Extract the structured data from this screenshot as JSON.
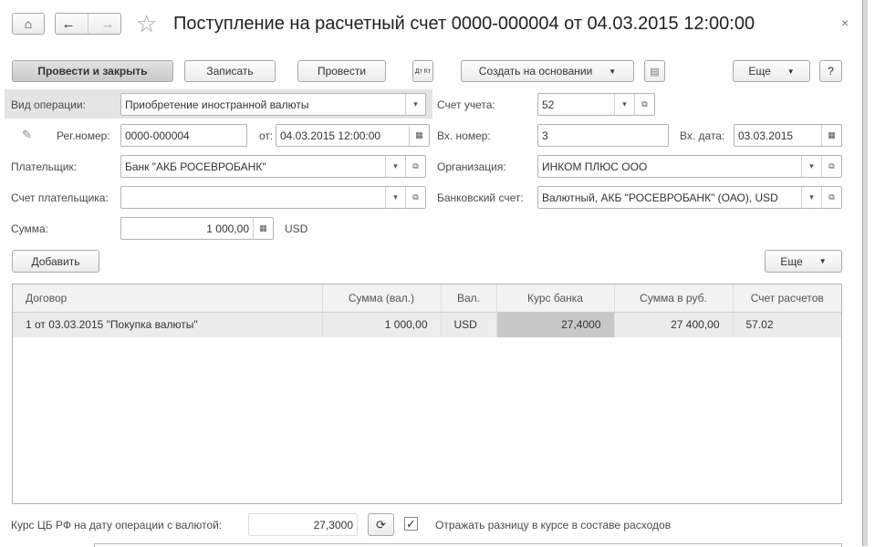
{
  "header": {
    "title": "Поступление на расчетный счет 0000-000004 от 04.03.2015 12:00:00",
    "home_icon": "home-icon",
    "back_icon": "arrow-left-icon",
    "forward_icon": "arrow-right-icon",
    "favorite_icon": "star-icon",
    "close_icon": "close-icon"
  },
  "toolbar": {
    "post_close": "Провести и закрыть",
    "save": "Записать",
    "post": "Провести",
    "dtkt": "Дт Кт",
    "create_based": "Создать на основании",
    "more": "Еще",
    "help": "?"
  },
  "form": {
    "operation_label": "Вид операции:",
    "operation_value": "Приобретение иностранной валюты",
    "account_label": "Счет учета:",
    "account_value": "52",
    "reg_label": "Рег.номер:",
    "reg_value": "0000-000004",
    "from_label": "от:",
    "from_value": "04.03.2015 12:00:00",
    "in_number_label": "Вх. номер:",
    "in_number_value": "3",
    "in_date_label": "Вх. дата:",
    "in_date_value": "03.03.2015",
    "payer_label": "Плательщик:",
    "payer_value": "Банк \"АКБ РОСЕВРОБАНК\"",
    "org_label": "Организация:",
    "org_value": "ИНКОМ ПЛЮС ООО",
    "payer_account_label": "Счет плательщика:",
    "payer_account_value": "",
    "bank_account_label": "Банковский счет:",
    "bank_account_value": "Валютный, АКБ \"РОСЕВРОБАНК\" (ОАО), USD",
    "sum_label": "Сумма:",
    "sum_value": "1 000,00",
    "currency": "USD"
  },
  "table": {
    "add": "Добавить",
    "more": "Еще",
    "columns": [
      "Договор",
      "Сумма (вал.)",
      "Вал.",
      "Курс банка",
      "Сумма в руб.",
      "Счет расчетов"
    ],
    "rows": [
      [
        "1 от 03.03.2015 \"Покупка валюты\"",
        "1 000,00",
        "USD",
        "27,4000",
        "27 400,00",
        "57.02"
      ]
    ]
  },
  "footer": {
    "cb_rate_label": "Курс ЦБ РФ на дату операции с валютой:",
    "cb_rate_value": "27,3000",
    "reflect_label": "Отражать разницу в курсе в составе расходов",
    "reflect_checked": true
  }
}
